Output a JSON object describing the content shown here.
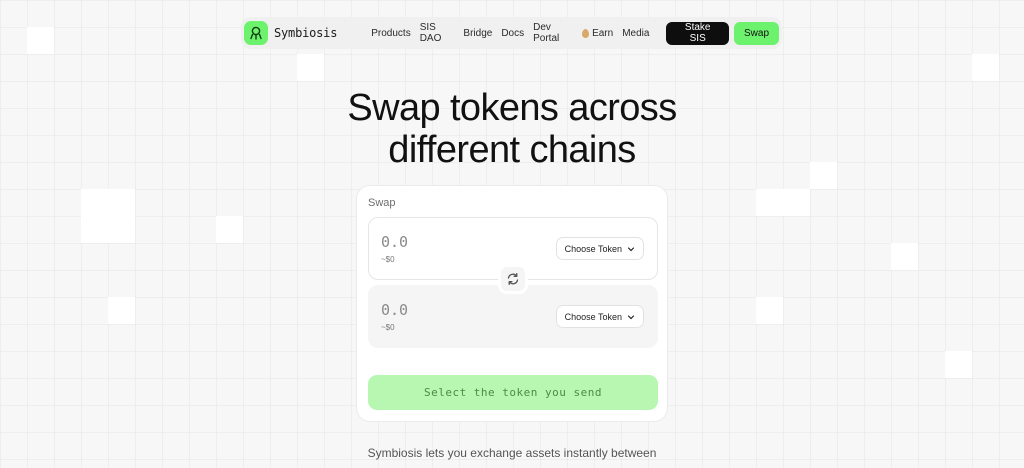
{
  "brand": {
    "name": "Symbiosis"
  },
  "nav": {
    "items": [
      {
        "label": "Products"
      },
      {
        "label": "SIS DAO"
      },
      {
        "label": "Bridge"
      },
      {
        "label": "Docs"
      },
      {
        "label": "Dev Portal"
      },
      {
        "label": "Earn",
        "icon": "earn-coin-icon"
      },
      {
        "label": "Media"
      }
    ],
    "stake_label": "Stake SIS",
    "swap_label": "Swap"
  },
  "hero": {
    "line1": "Swap tokens across",
    "line2": "different chains"
  },
  "swap_card": {
    "title": "Swap",
    "from": {
      "placeholder": "0.0",
      "usd": "~$0",
      "token_button": "Choose Token"
    },
    "to": {
      "placeholder": "0.0",
      "usd": "~$0",
      "token_button": "Choose Token"
    },
    "switch_icon": "swap-arrows-icon",
    "submit_label": "Select the token you send"
  },
  "description": "Symbiosis lets you exchange assets instantly between",
  "colors": {
    "accent": "#6cf26c",
    "dark": "#0e0e0e",
    "submit_disabled": "#b8f7b1"
  }
}
